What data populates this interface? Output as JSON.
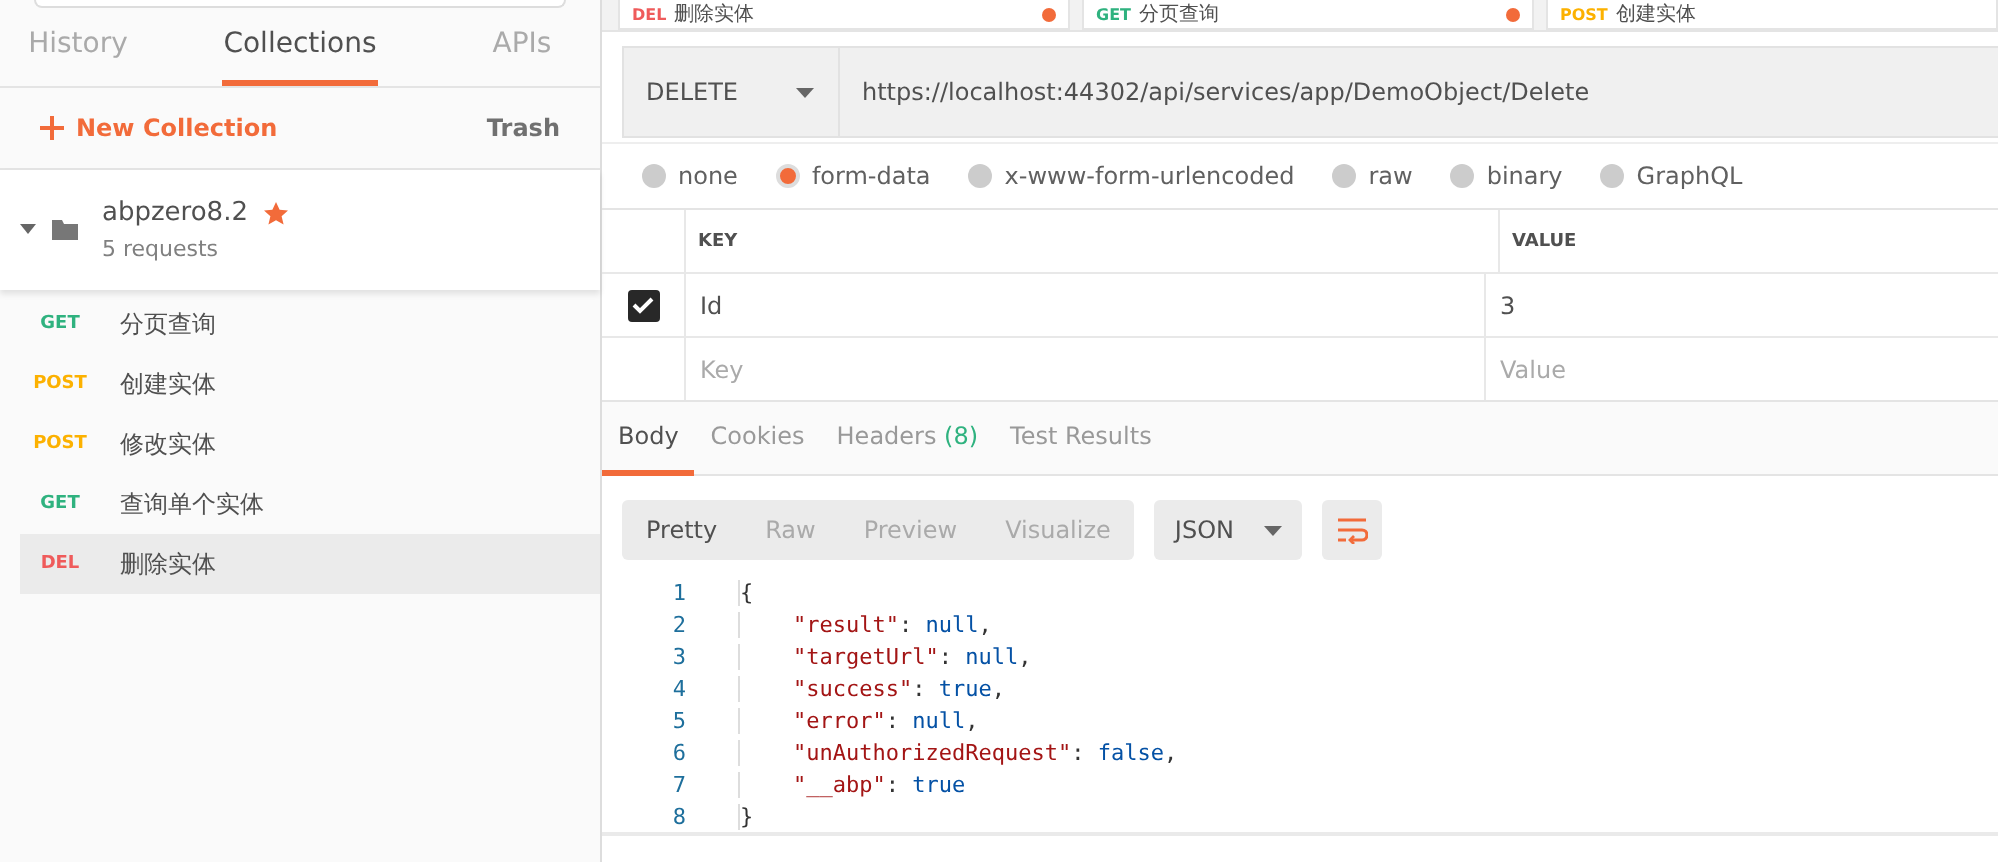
{
  "sidebar": {
    "tabs": [
      {
        "label": "History",
        "selected": false
      },
      {
        "label": "Collections",
        "selected": true
      },
      {
        "label": "APIs",
        "selected": false
      }
    ],
    "new_collection": "New Collection",
    "trash": "Trash",
    "collection": {
      "name": "abpzero8.2",
      "starred": true,
      "expanded": true,
      "count": "5 requests",
      "requests": [
        {
          "method": "GET",
          "name": "分页查询",
          "selected": false
        },
        {
          "method": "POST",
          "name": "创建实体",
          "selected": false
        },
        {
          "method": "POST",
          "name": "修改实体",
          "selected": false
        },
        {
          "method": "GET",
          "name": "查询单个实体",
          "selected": false
        },
        {
          "method": "DEL",
          "name": "删除实体",
          "selected": true
        }
      ]
    }
  },
  "request_tabs": [
    {
      "method": "DEL",
      "name": "删除实体",
      "unsaved": true
    },
    {
      "method": "GET",
      "name": "分页查询",
      "unsaved": true
    },
    {
      "method": "POST",
      "name": "创建实体",
      "unsaved": false
    }
  ],
  "request": {
    "method": "DELETE",
    "url": "https://localhost:44302/api/services/app/DemoObject/Delete"
  },
  "body_types": [
    {
      "label": "none",
      "selected": false
    },
    {
      "label": "form-data",
      "selected": true
    },
    {
      "label": "x-www-form-urlencoded",
      "selected": false
    },
    {
      "label": "raw",
      "selected": false
    },
    {
      "label": "binary",
      "selected": false
    },
    {
      "label": "GraphQL",
      "selected": false
    }
  ],
  "params": {
    "columns": [
      "KEY",
      "VALUE"
    ],
    "rows": [
      {
        "checked": true,
        "key": "Id",
        "value": "3"
      }
    ],
    "new_row": {
      "key_placeholder": "Key",
      "value_placeholder": "Value"
    }
  },
  "response_tabs": [
    {
      "label": "Body",
      "selected": true
    },
    {
      "label": "Cookies",
      "selected": false
    },
    {
      "label": "Headers",
      "count": "(8)",
      "selected": false
    },
    {
      "label": "Test Results",
      "selected": false
    }
  ],
  "view_modes": [
    {
      "label": "Pretty",
      "selected": true
    },
    {
      "label": "Raw",
      "selected": false
    },
    {
      "label": "Preview",
      "selected": false
    },
    {
      "label": "Visualize",
      "selected": false
    }
  ],
  "format": "JSON",
  "code": [
    {
      "number": "1",
      "tokens": [
        {
          "kind": "punct",
          "text": "{"
        }
      ]
    },
    {
      "number": "2",
      "tokens": [
        {
          "kind": "key",
          "text": "    \"result\""
        },
        {
          "kind": "punct",
          "text": ": "
        },
        {
          "kind": "literal",
          "text": "null"
        },
        {
          "kind": "punct",
          "text": ","
        }
      ]
    },
    {
      "number": "3",
      "tokens": [
        {
          "kind": "key",
          "text": "    \"targetUrl\""
        },
        {
          "kind": "punct",
          "text": ": "
        },
        {
          "kind": "literal",
          "text": "null"
        },
        {
          "kind": "punct",
          "text": ","
        }
      ]
    },
    {
      "number": "4",
      "tokens": [
        {
          "kind": "key",
          "text": "    \"success\""
        },
        {
          "kind": "punct",
          "text": ": "
        },
        {
          "kind": "literal",
          "text": "true"
        },
        {
          "kind": "punct",
          "text": ","
        }
      ]
    },
    {
      "number": "5",
      "tokens": [
        {
          "kind": "key",
          "text": "    \"error\""
        },
        {
          "kind": "punct",
          "text": ": "
        },
        {
          "kind": "literal",
          "text": "null"
        },
        {
          "kind": "punct",
          "text": ","
        }
      ]
    },
    {
      "number": "6",
      "tokens": [
        {
          "kind": "key",
          "text": "    \"unAuthorizedRequest\""
        },
        {
          "kind": "punct",
          "text": ": "
        },
        {
          "kind": "literal",
          "text": "false"
        },
        {
          "kind": "punct",
          "text": ","
        }
      ]
    },
    {
      "number": "7",
      "tokens": [
        {
          "kind": "key",
          "text": "    \"__abp\""
        },
        {
          "kind": "punct",
          "text": ": "
        },
        {
          "kind": "literal",
          "text": "true"
        }
      ]
    },
    {
      "number": "8",
      "tokens": [
        {
          "kind": "punct",
          "text": "}"
        }
      ]
    }
  ]
}
